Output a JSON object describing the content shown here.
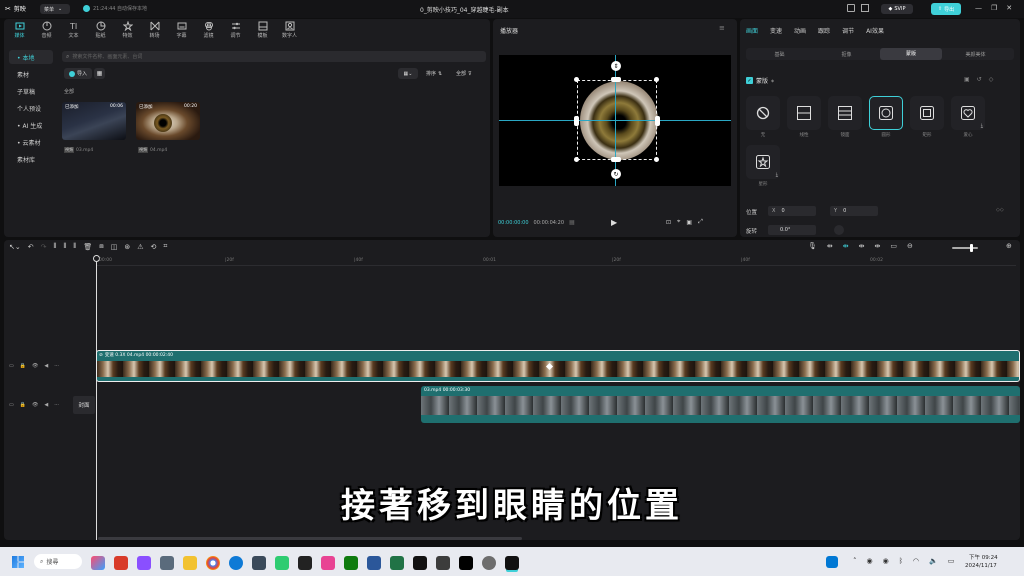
{
  "titlebar": {
    "app_name": "剪映",
    "menu_label": "菜单",
    "autosave": "21:24:44 自动保存本地",
    "project_title": "0_剪映小技巧_04_穿越睫毛-副本",
    "svip": "SVIP",
    "publish": "导出"
  },
  "toolbar": {
    "tools": [
      {
        "label": "媒体",
        "icon": "media-icon"
      },
      {
        "label": "音频",
        "icon": "audio-icon"
      },
      {
        "label": "文本",
        "icon": "text-icon"
      },
      {
        "label": "贴纸",
        "icon": "sticker-icon"
      },
      {
        "label": "特效",
        "icon": "effects-icon"
      },
      {
        "label": "转场",
        "icon": "transition-icon"
      },
      {
        "label": "字幕",
        "icon": "subtitle-icon"
      },
      {
        "label": "滤镜",
        "icon": "filter-icon"
      },
      {
        "label": "调节",
        "icon": "adjust-icon"
      },
      {
        "label": "模板",
        "icon": "template-icon"
      },
      {
        "label": "数字人",
        "icon": "avatar-icon"
      }
    ]
  },
  "sidebar": {
    "items": [
      {
        "label": "• 本地"
      },
      {
        "label": "素材"
      },
      {
        "label": "子草稿"
      },
      {
        "label": "个人预设"
      },
      {
        "label": "• AI 生成"
      },
      {
        "label": "• 云素材"
      },
      {
        "label": "素材库"
      }
    ]
  },
  "media_panel": {
    "search_placeholder": "搜索文件名称、画面元素、台词",
    "import_label": "导入",
    "sort_label": "排序",
    "all_label": "全部",
    "section_label": "全部",
    "items": [
      {
        "tag": "已添加",
        "duration": "00:06",
        "file": "03.mp4"
      },
      {
        "tag": "已添加",
        "duration": "00:20",
        "file": "04.mp4"
      }
    ]
  },
  "player": {
    "title": "播放器",
    "current_time": "00:00:00:00",
    "total_time": "00:00:04:20"
  },
  "inspector": {
    "tabs": [
      "画面",
      "变速",
      "动画",
      "跟踪",
      "调节",
      "AI效果"
    ],
    "subtabs": [
      "基础",
      "抠像",
      "蒙版",
      "美颜美体"
    ],
    "mask_label": "蒙版",
    "shapes": [
      {
        "label": "无",
        "icon": "none-icon"
      },
      {
        "label": "线性",
        "icon": "linear-mask-icon"
      },
      {
        "label": "镜面",
        "icon": "mirror-mask-icon"
      },
      {
        "label": "圆形",
        "icon": "circle-mask-icon"
      },
      {
        "label": "矩形",
        "icon": "rect-mask-icon"
      },
      {
        "label": "爱心",
        "icon": "heart-mask-icon"
      },
      {
        "label": "星形",
        "icon": "star-mask-icon"
      }
    ],
    "position_label": "位置",
    "x_label": "X",
    "x_value": "0",
    "y_label": "Y",
    "y_value": "0",
    "rotate_label": "旋转",
    "rotate_value": "0.0°"
  },
  "timeline": {
    "ruler": [
      "00:00",
      "|20f",
      "|40f",
      "00:01",
      "|20f",
      "|40f",
      "00:02"
    ],
    "main_clip": "变速 0.3X  04.mp4  00:00:02:40",
    "second_clip": "03.mp4  00:00:03:30",
    "cover_label": "封面"
  },
  "subtitle": "接著移到眼睛的位置",
  "taskbar": {
    "search": "搜尋",
    "time": "下午 09:24",
    "date": "2024/11/17"
  },
  "colors": {
    "accent": "#3fd0d8",
    "clip": "#1f6f6f",
    "panel": "#1c1c1f"
  }
}
